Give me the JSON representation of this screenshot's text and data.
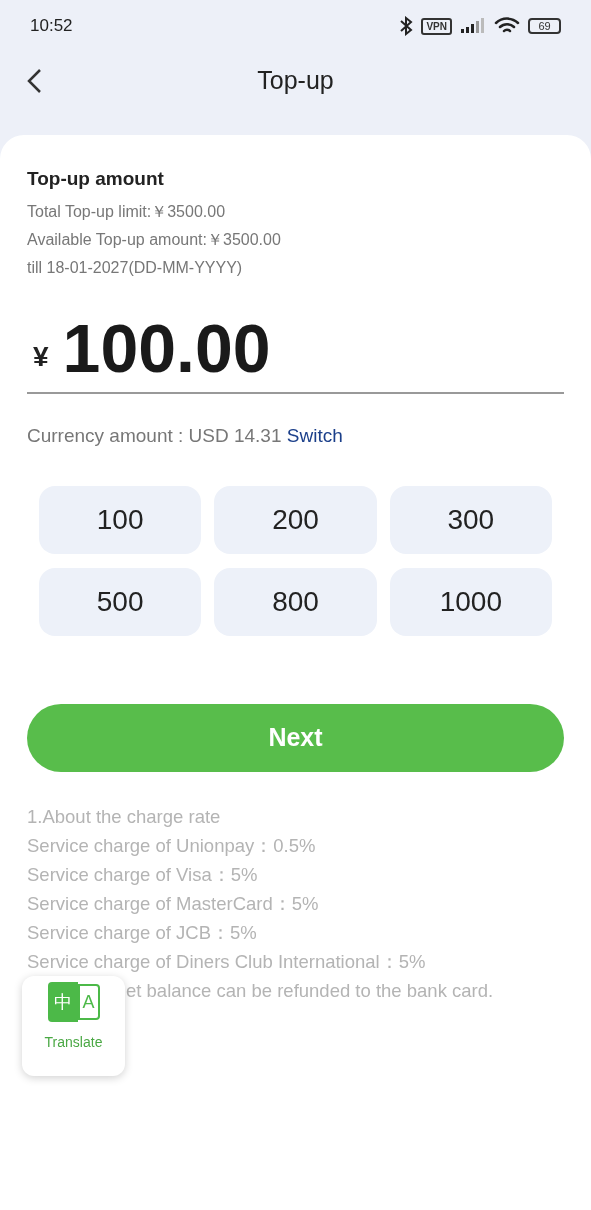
{
  "status_bar": {
    "time": "10:52",
    "vpn": "VPN",
    "battery": "69"
  },
  "header": {
    "title": "Top-up"
  },
  "limits": {
    "title": "Top-up amount",
    "lines": [
      "Total Top-up limit:￥3500.00",
      "Available Top-up amount:￥3500.00",
      "till 18-01-2027(DD-MM-YYYY)"
    ]
  },
  "amount_field": {
    "currency": "¥",
    "value": "100.00"
  },
  "conversion": {
    "text": "Currency amount : USD 14.31",
    "link": "Switch"
  },
  "amount_options": [
    {
      "label": "100",
      "selected": false
    },
    {
      "label": "200",
      "selected": false
    },
    {
      "label": "300",
      "selected": false
    },
    {
      "label": "500",
      "selected": false
    },
    {
      "label": "800",
      "selected": false
    },
    {
      "label": "1000",
      "selected": false
    }
  ],
  "next_button": "Next",
  "notes": [
    {
      "text": "1.About the charge rate",
      "partly_covered": false
    },
    {
      "text": "Service charge of Unionpay：0.5%",
      "partly_covered": false
    },
    {
      "text": "Service charge of Visa：5%",
      "partly_covered": false
    },
    {
      "text": "Service charge of MasterCard：5%",
      "partly_covered": false
    },
    {
      "text": "Service charge of JCB：5%",
      "partly_covered": false
    },
    {
      "text": "Service charge of Diners Club International：5%",
      "partly_covered": false
    },
    {
      "text": "et balance can be refunded to the bank card.",
      "partly_covered": true
    }
  ],
  "translate_widget": {
    "glyph_left": "中",
    "glyph_right": "A",
    "label": "Translate"
  }
}
